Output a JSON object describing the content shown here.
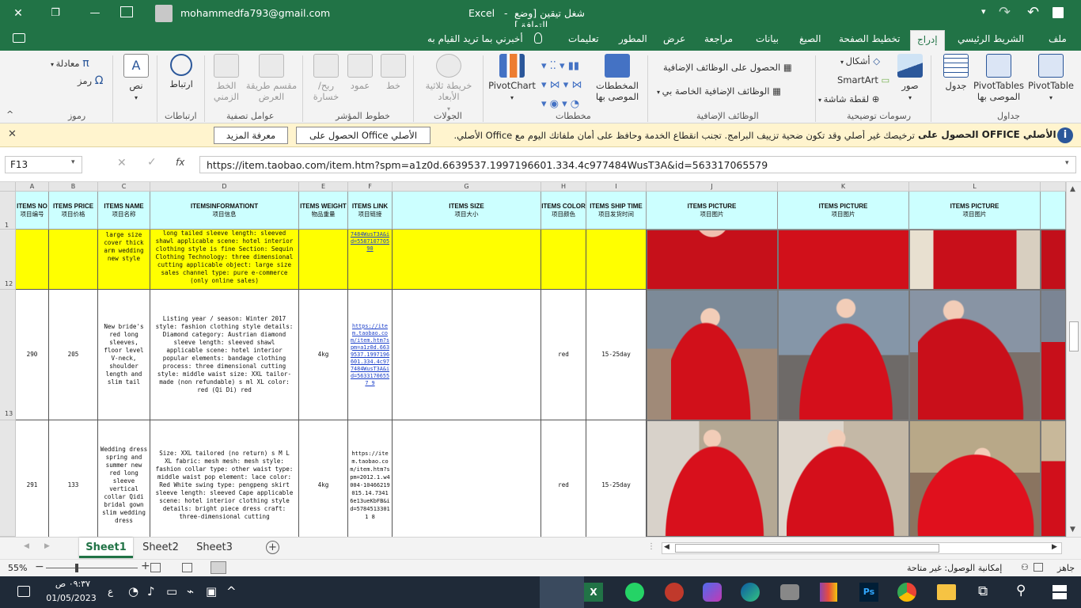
{
  "titlebar": {
    "file_title": "شغل تيقين  [وضع التوافق]",
    "app_name": "Excel",
    "account": "mohammedfa793@gmail.com",
    "minimize_glyph": "—",
    "restore_glyph": "❐",
    "close_glyph": "✕",
    "save_glyph": "💾",
    "undo_glyph": "↶",
    "redo_glyph": "↷"
  },
  "menu": {
    "items": [
      "ملف",
      "الشريط الرئيسي",
      "إدراج",
      "تخطيط الصفحة",
      "الصيغ",
      "بيانات",
      "مراجعة",
      "عرض",
      "المطور",
      "تعليمات"
    ],
    "active": "إدراج",
    "tell_me": "أخبرني بما تريد القيام به"
  },
  "ribbon": {
    "tables": {
      "pivottable": "PivotTable",
      "recommended_pivot": "PivotTables الموصى بها",
      "table": "جدول",
      "group": "جداول"
    },
    "illustrations": {
      "pictures": "صور",
      "shapes": "أشكال",
      "smartart": "SmartArt",
      "screenshot": "لقطة شاشة",
      "group": "رسومات توضيحية"
    },
    "addins": {
      "get_addins": "الحصول على الوظائف الإضافية",
      "my_addins": "الوظائف الإضافية الخاصة بي",
      "group": "الوظائف الإضافية"
    },
    "charts": {
      "recommended": "المخططات الموصى بها",
      "pivotchart": "PivotChart",
      "group": "مخططات"
    },
    "tours": {
      "map3d": "خريطة ثلاثية الأبعاد",
      "group": "الجولات"
    },
    "sparklines": {
      "line": "خط",
      "column": "عمود",
      "winloss": "ربح/ خسارة",
      "group": "خطوط المؤشر"
    },
    "filters": {
      "slicer": "مقسم طريقة العرض",
      "timeline": "الخط الزمني",
      "group": "عوامل تصفية"
    },
    "links": {
      "link": "ارتباط",
      "group": "ارتباطات"
    },
    "text": {
      "text": "نص"
    },
    "symbols": {
      "equation": "معادلة",
      "symbol": "رمز",
      "group": "رموز"
    }
  },
  "infobar": {
    "title": "الحصول على OFFICE الأصلي",
    "message": "ترخيصك غير أصلي وقد تكون ضحية تزييف البرامج. تجنب انقطاع الخدمة وحافظ على أمان ملفاتك اليوم مع Office الأصلي.",
    "get_button": "الحصول على Office الأصلي",
    "learn_button": "معرفة المزيد"
  },
  "formula": {
    "name_box": "F13",
    "fx": "fx",
    "content": "https://item.taobao.com/item.htm?spm=a1z0d.6639537.1997196601.334.4c977484WusT3A&id=563317065579"
  },
  "grid": {
    "col_letters": [
      "A",
      "B",
      "C",
      "D",
      "E",
      "F",
      "G",
      "H",
      "I",
      "J",
      "K",
      "L"
    ],
    "headers": [
      {
        "en": "ITEMS NO",
        "cn": "项目编号"
      },
      {
        "en": "ITEMS PRICE",
        "cn": "项目价格"
      },
      {
        "en": "ITEMS NAME",
        "cn": "项目名称"
      },
      {
        "en": "ITEMSINFORMATIONT",
        "cn": "项目信息"
      },
      {
        "en": "ITEMS WEIGHT",
        "cn": "物品重量"
      },
      {
        "en": "ITEMS LINK",
        "cn": "项目链接"
      },
      {
        "en": "ITEMS SIZE",
        "cn": "项目大小"
      },
      {
        "en": "ITEMS COLOR",
        "cn": "项目颜色"
      },
      {
        "en": "ITEMS SHIP TIME",
        "cn": "项目发货时间"
      },
      {
        "en": "ITEMS PICTURE",
        "cn": "项目图片"
      },
      {
        "en": "ITEMS PICTURE",
        "cn": "项目图片"
      },
      {
        "en": "ITEMS PICTURE",
        "cn": "项目图片"
      }
    ],
    "row_numbers": [
      "1",
      "12",
      "13"
    ],
    "rows": [
      {
        "no": "",
        "price": "",
        "name": "large size cover thick arm wedding new style",
        "info": "long tailed sleeve length: sleeved shawl applicable scene: hotel interior clothing style is fine Section: Sequin Clothing Technology: three dimensional cutting applicable object: large size sales channel type: pure e-commerce (only online sales)",
        "weight": "",
        "link": "7484WusT3A&id=5587107705 90",
        "size": "",
        "color": "",
        "ship": ""
      },
      {
        "no": "290",
        "price": "205",
        "name": "New bride's red long sleeves, floor level V-neck, shoulder length and slim tail",
        "info": "Listing year / season: Winter 2017 style: fashion clothing style details: Diamond category: Austrian diamond sleeve length: sleeved shawl applicable scene: hotel interior popular elements: bandage clothing process: three dimensional cutting style: middle waist size: XXL tailor-made (non refundable) s ml XL color: red (Qi Di) red",
        "weight": "4kg",
        "link": "https://item.taobao.com/item.htm?spm=a1z0d.6639537.1997196601.334.4c977484WusT3A&id=56331706557 9",
        "size": "",
        "color": "red",
        "ship": "15-25day"
      },
      {
        "no": "291",
        "price": "133",
        "name": "Wedding dress spring and summer new red long sleeve vertical collar Qidi bridal gown slim wedding dress",
        "info": "Size: XXL tailored (no return) s M L XL fabric: mesh mesh: mesh style: fashion collar type: other waist type: middle waist pop element: lace color: Red White swing type: pengpeng skirt sleeve length: sleeved Cape applicable scene: hotel interior clothing style details: bright piece dress craft: three-dimensional cutting",
        "weight": "4kg",
        "link": "https://item.taobao.com/item.htm?spm=2012.1.w4004-10466219015.14.7341 6e13ueKbFB&id=57845133011 8",
        "size": "",
        "color": "red",
        "ship": "15-25day"
      }
    ]
  },
  "sheets": {
    "tabs": [
      "Sheet1",
      "Sheet2",
      "Sheet3"
    ],
    "active": "Sheet1"
  },
  "status": {
    "ready": "جاهز",
    "accessibility": "إمكانية الوصول: غير متاحة",
    "zoom": "55%"
  },
  "taskbar": {
    "time": "٠٩:٣٧ ص",
    "date": "01/05/2023",
    "lang": "ع"
  },
  "colors": {
    "excel_green": "#217346",
    "header_cyan": "#ccffff",
    "highlight_yellow": "#ffff00",
    "link_blue": "#1a3ec9",
    "dress_red": "#d1101a"
  }
}
